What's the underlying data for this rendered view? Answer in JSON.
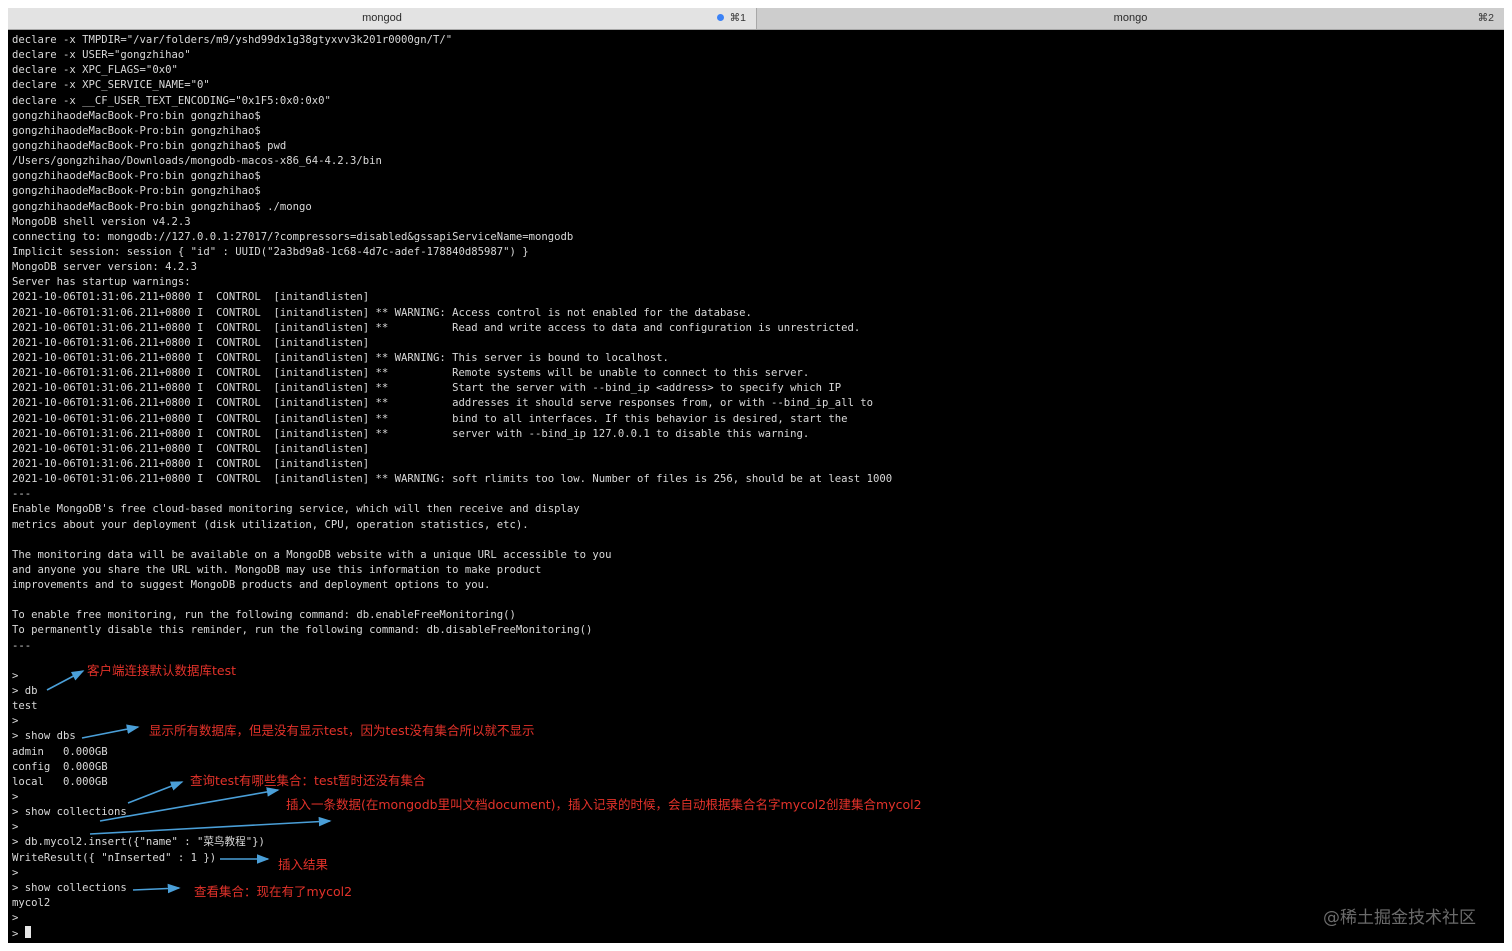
{
  "tabs": [
    {
      "title": "mongod",
      "shortcut": "⌘1"
    },
    {
      "title": "mongo",
      "shortcut": "⌘2"
    }
  ],
  "terminal_lines": [
    "declare -x TMPDIR=\"/var/folders/m9/yshd99dx1g38gtyxvv3k201r0000gn/T/\"",
    "declare -x USER=\"gongzhihao\"",
    "declare -x XPC_FLAGS=\"0x0\"",
    "declare -x XPC_SERVICE_NAME=\"0\"",
    "declare -x __CF_USER_TEXT_ENCODING=\"0x1F5:0x0:0x0\"",
    "gongzhihaodeMacBook-Pro:bin gongzhihao$",
    "gongzhihaodeMacBook-Pro:bin gongzhihao$",
    "gongzhihaodeMacBook-Pro:bin gongzhihao$ pwd",
    "/Users/gongzhihao/Downloads/mongodb-macos-x86_64-4.2.3/bin",
    "gongzhihaodeMacBook-Pro:bin gongzhihao$",
    "gongzhihaodeMacBook-Pro:bin gongzhihao$",
    "gongzhihaodeMacBook-Pro:bin gongzhihao$ ./mongo",
    "MongoDB shell version v4.2.3",
    "connecting to: mongodb://127.0.0.1:27017/?compressors=disabled&gssapiServiceName=mongodb",
    "Implicit session: session { \"id\" : UUID(\"2a3bd9a8-1c68-4d7c-adef-178840d85987\") }",
    "MongoDB server version: 4.2.3",
    "Server has startup warnings:",
    "2021-10-06T01:31:06.211+0800 I  CONTROL  [initandlisten]",
    "2021-10-06T01:31:06.211+0800 I  CONTROL  [initandlisten] ** WARNING: Access control is not enabled for the database.",
    "2021-10-06T01:31:06.211+0800 I  CONTROL  [initandlisten] **          Read and write access to data and configuration is unrestricted.",
    "2021-10-06T01:31:06.211+0800 I  CONTROL  [initandlisten]",
    "2021-10-06T01:31:06.211+0800 I  CONTROL  [initandlisten] ** WARNING: This server is bound to localhost.",
    "2021-10-06T01:31:06.211+0800 I  CONTROL  [initandlisten] **          Remote systems will be unable to connect to this server.",
    "2021-10-06T01:31:06.211+0800 I  CONTROL  [initandlisten] **          Start the server with --bind_ip <address> to specify which IP",
    "2021-10-06T01:31:06.211+0800 I  CONTROL  [initandlisten] **          addresses it should serve responses from, or with --bind_ip_all to",
    "2021-10-06T01:31:06.211+0800 I  CONTROL  [initandlisten] **          bind to all interfaces. If this behavior is desired, start the",
    "2021-10-06T01:31:06.211+0800 I  CONTROL  [initandlisten] **          server with --bind_ip 127.0.0.1 to disable this warning.",
    "2021-10-06T01:31:06.211+0800 I  CONTROL  [initandlisten]",
    "2021-10-06T01:31:06.211+0800 I  CONTROL  [initandlisten]",
    "2021-10-06T01:31:06.211+0800 I  CONTROL  [initandlisten] ** WARNING: soft rlimits too low. Number of files is 256, should be at least 1000",
    "---",
    "Enable MongoDB's free cloud-based monitoring service, which will then receive and display",
    "metrics about your deployment (disk utilization, CPU, operation statistics, etc).",
    "",
    "The monitoring data will be available on a MongoDB website with a unique URL accessible to you",
    "and anyone you share the URL with. MongoDB may use this information to make product",
    "improvements and to suggest MongoDB products and deployment options to you.",
    "",
    "To enable free monitoring, run the following command: db.enableFreeMonitoring()",
    "To permanently disable this reminder, run the following command: db.disableFreeMonitoring()",
    "---",
    "",
    ">",
    "> db",
    "test",
    ">",
    "> show dbs",
    "admin   0.000GB",
    "config  0.000GB",
    "local   0.000GB",
    ">",
    "> show collections",
    ">",
    "> db.mycol2.insert({\"name\" : \"菜鸟教程\"})",
    "WriteResult({ \"nInserted\" : 1 })",
    ">",
    "> show collections",
    "mycol2",
    ">",
    "> "
  ],
  "annotations": [
    "客户端连接默认数据库test",
    "显示所有数据库，但是没有显示test，因为test没有集合所以就不显示",
    "查询test有哪些集合：test暂时还没有集合",
    "插入一条数据(在mongodb里叫文档document)，插入记录的时候，会自动根据集合名字mycol2创建集合mycol2",
    "插入结果",
    "查看集合：现在有了mycol2"
  ],
  "watermark": "@稀土掘金技术社区",
  "colors": {
    "terminal_bg": "#000000",
    "terminal_fg": "#d9d9d9",
    "annotation": "#e3322a",
    "arrow": "#4a9fd8",
    "tab_indicator": "#3b82f6"
  }
}
